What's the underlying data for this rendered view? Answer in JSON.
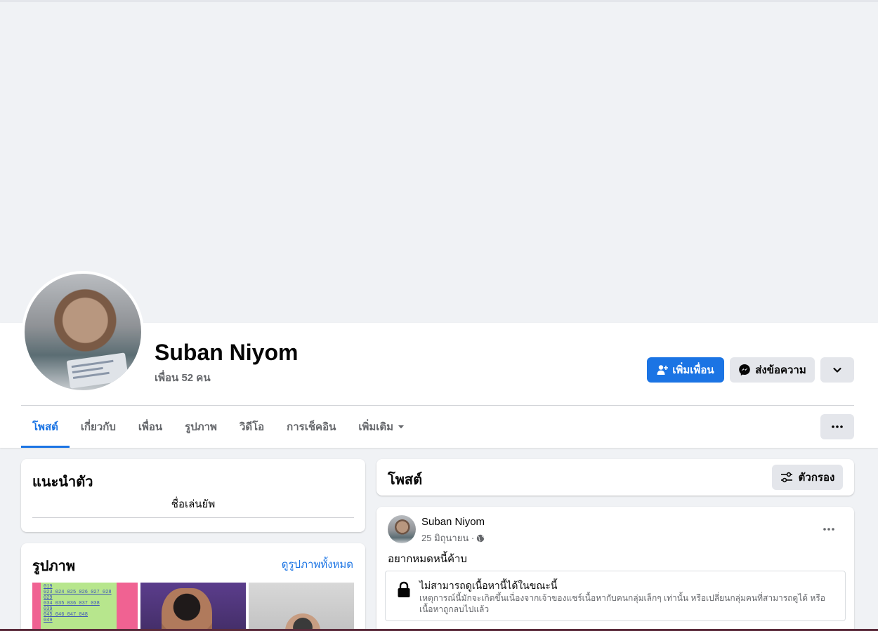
{
  "profile": {
    "name": "Suban Niyom",
    "friends_count": "เพื่อน 52 คน"
  },
  "actions": {
    "add_friend": "เพิ่มเพื่อน",
    "message": "ส่งข้อความ"
  },
  "tabs": [
    {
      "label": "โพสต์",
      "active": true
    },
    {
      "label": "เกี่ยวกับ"
    },
    {
      "label": "เพื่อน"
    },
    {
      "label": "รูปภาพ"
    },
    {
      "label": "วิดีโอ"
    },
    {
      "label": "การเช็คอิน"
    },
    {
      "label": "เพิ่มเติม"
    }
  ],
  "intro": {
    "title": "แนะนำตัว",
    "bio": "ชื่อเล่นยัพ"
  },
  "photos": {
    "title": "รูปภาพ",
    "see_all": "ดูรูปภาพทั้งหมด",
    "thumb1_lines": [
      "019",
      "023 024 025 026 027 028",
      "029",
      "034 035 036 037 038",
      "039",
      "045 046 047 048",
      "049"
    ]
  },
  "posts": {
    "title": "โพสต์",
    "filter_label": "ตัวกรอง"
  },
  "post": {
    "author": "Suban Niyom",
    "date": "25 มิถุนายน ·",
    "text": "อยากหมดหนี้ค้าบ",
    "unavailable_title": "ไม่สามารถดูเนื้อหานี้ได้ในขณะนี้",
    "unavailable_desc": "เหตุการณ์นี้มักจะเกิดขึ้นเนื่องจากเจ้าของแชร์เนื้อหากับคนกลุ่มเล็กๆ เท่านั้น หรือเปลี่ยนกลุ่มคนที่สามารถดูได้ หรือเนื้อหาถูกลบไปแล้ว"
  },
  "colors": {
    "accent": "#1b74e4",
    "page_bg": "#f0f2f5",
    "secondary_button": "#e4e6eb",
    "muted_text": "#65676b"
  }
}
